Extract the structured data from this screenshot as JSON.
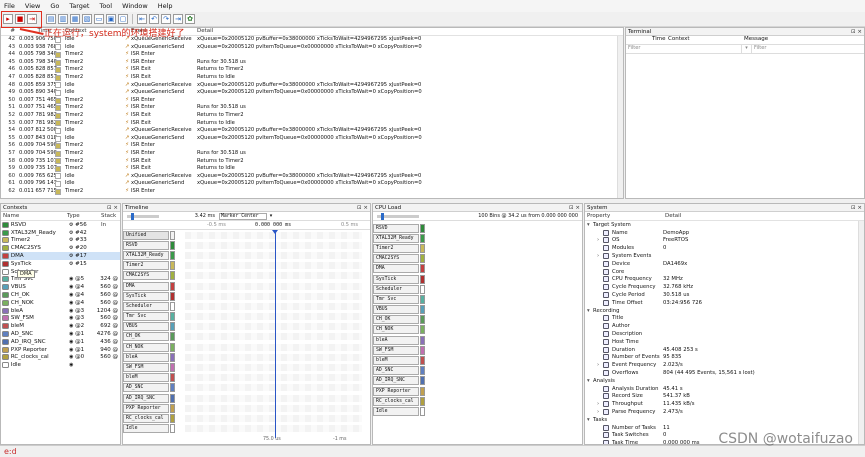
{
  "menu": [
    "File",
    "View",
    "Go",
    "Target",
    "Tool",
    "Window",
    "Help"
  ],
  "annotation": "正在运行，system的环境搭建好了",
  "events": {
    "columns": [
      "#",
      "Time",
      "Context",
      "",
      "Event",
      "Detail"
    ],
    "rows": [
      {
        "n": "42",
        "t": "0.003 906 750",
        "ctx": "Idle",
        "c": "#ffffff",
        "ic": "↗",
        "ev": "xQueueGenericReceive",
        "det": "xQueue=0x20005120 pvBuffer=0x38000000 xTicksToWait=4294967295 xJustPeek=0"
      },
      {
        "n": "43",
        "t": "0.003 938 768",
        "ctx": "Idle",
        "c": "#ffffff",
        "ic": "↗",
        "ev": "xQueueGenericSend",
        "det": "xQueue=0x20005120 pvItemToQueue=0x00000000 xTicksToWait=0 xCopyPosition=0"
      },
      {
        "n": "44",
        "t": "0.005 798 340",
        "ctx": "Timer2",
        "c": "#c8b85a",
        "ic": "⚡",
        "ev": "ISR Enter",
        "det": ""
      },
      {
        "n": "45",
        "t": "0.005 798 340",
        "ctx": "Timer2",
        "c": "#c8b85a",
        "ic": "⚡",
        "ev": "ISR Enter",
        "det": "Runs for 30.518 us"
      },
      {
        "n": "46",
        "t": "0.005 828 857",
        "ctx": "Timer2",
        "c": "#c8b85a",
        "ic": "⚡",
        "ev": "ISR Exit",
        "det": "Returns to Timer2"
      },
      {
        "n": "47",
        "t": "0.005 828 857",
        "ctx": "Timer2",
        "c": "#c8b85a",
        "ic": "⚡",
        "ev": "ISR Exit",
        "det": "Returns to Idle"
      },
      {
        "n": "48",
        "t": "0.005 859 375",
        "ctx": "Idle",
        "c": "#ffffff",
        "ic": "↗",
        "ev": "xQueueGenericReceive",
        "det": "xQueue=0x20005120 pvBuffer=0x38000000 xTicksToWait=4294967295 xJustPeek=0"
      },
      {
        "n": "49",
        "t": "0.005 890 340",
        "ctx": "Idle",
        "c": "#ffffff",
        "ic": "↗",
        "ev": "xQueueGenericSend",
        "det": "xQueue=0x20005120 pvItemToQueue=0x00000000 xTicksToWait=0 xCopyPosition=0"
      },
      {
        "n": "50",
        "t": "0.007 751 465",
        "ctx": "Timer2",
        "c": "#c8b85a",
        "ic": "⚡",
        "ev": "ISR Enter",
        "det": ""
      },
      {
        "n": "51",
        "t": "0.007 751 465",
        "ctx": "Timer2",
        "c": "#c8b85a",
        "ic": "⚡",
        "ev": "ISR Enter",
        "det": "Runs for 30.518 us"
      },
      {
        "n": "52",
        "t": "0.007 781 982",
        "ctx": "Timer2",
        "c": "#c8b85a",
        "ic": "⚡",
        "ev": "ISR Exit",
        "det": "Returns to Timer2"
      },
      {
        "n": "53",
        "t": "0.007 781 982",
        "ctx": "Timer2",
        "c": "#c8b85a",
        "ic": "⚡",
        "ev": "ISR Exit",
        "det": "Returns to Idle"
      },
      {
        "n": "54",
        "t": "0.007 812 500",
        "ctx": "Idle",
        "c": "#ffffff",
        "ic": "↗",
        "ev": "xQueueGenericReceive",
        "det": "xQueue=0x20005120 pvBuffer=0x38000000 xTicksToWait=4294967295 xJustPeek=0"
      },
      {
        "n": "55",
        "t": "0.007 843 018",
        "ctx": "Idle",
        "c": "#ffffff",
        "ic": "↗",
        "ev": "xQueueGenericSend",
        "det": "xQueue=0x20005120 pvItemToQueue=0x00000000 xTicksToWait=0 xCopyPosition=0"
      },
      {
        "n": "56",
        "t": "0.009 704 590",
        "ctx": "Timer2",
        "c": "#c8b85a",
        "ic": "⚡",
        "ev": "ISR Enter",
        "det": ""
      },
      {
        "n": "57",
        "t": "0.009 704 590",
        "ctx": "Timer2",
        "c": "#c8b85a",
        "ic": "⚡",
        "ev": "ISR Enter",
        "det": "Runs for 30.518 us"
      },
      {
        "n": "58",
        "t": "0.009 735 107",
        "ctx": "Timer2",
        "c": "#c8b85a",
        "ic": "⚡",
        "ev": "ISR Exit",
        "det": "Returns to Timer2"
      },
      {
        "n": "59",
        "t": "0.009 735 107",
        "ctx": "Timer2",
        "c": "#c8b85a",
        "ic": "⚡",
        "ev": "ISR Exit",
        "det": "Returns to Idle"
      },
      {
        "n": "60",
        "t": "0.009 765 625",
        "ctx": "Idle",
        "c": "#ffffff",
        "ic": "↗",
        "ev": "xQueueGenericReceive",
        "det": "xQueue=0x20005120 pvBuffer=0x38000000 xTicksToWait=4294967295 xJustPeek=0"
      },
      {
        "n": "61",
        "t": "0.009 796 143",
        "ctx": "Idle",
        "c": "#ffffff",
        "ic": "↗",
        "ev": "xQueueGenericSend",
        "det": "xQueue=0x20005120 pvItemToQueue=0x00000000 xTicksToWait=0 xCopyPosition=0"
      },
      {
        "n": "62",
        "t": "0.011 657 715",
        "ctx": "Timer2",
        "c": "#c8b85a",
        "ic": "⚡",
        "ev": "ISR Enter",
        "det": ""
      }
    ]
  },
  "terminal": {
    "title": "Terminal",
    "cols": [
      "Time",
      "Context",
      "Message"
    ],
    "filter": "Filter"
  },
  "contexts": {
    "title": "Contexts",
    "cols": [
      "Name",
      "Type",
      "Stack In"
    ],
    "rows": [
      {
        "name": "RSVD",
        "c": "#2e8b3a",
        "type": "⚙",
        "prio": "#56",
        "stack": ""
      },
      {
        "name": "XTAL32M_Ready",
        "c": "#3a9a4a",
        "type": "⚙",
        "prio": "#42",
        "stack": ""
      },
      {
        "name": "Timer2",
        "c": "#c8b85a",
        "type": "⚙",
        "prio": "#33",
        "stack": ""
      },
      {
        "name": "CMAC2SYS",
        "c": "#a0b040",
        "type": "⚙",
        "prio": "#20",
        "stack": ""
      },
      {
        "name": "DMA",
        "c": "#c44040",
        "type": "⚙",
        "prio": "#17",
        "stack": ""
      },
      {
        "name": "SysTick",
        "c": "#b03030",
        "type": "⚙",
        "prio": "#15",
        "stack": ""
      },
      {
        "name": "Scheduler",
        "c": "#ffffff",
        "type": "",
        "prio": "",
        "stack": ""
      },
      {
        "name": "Tmr Svc",
        "c": "#58b0a0",
        "type": "◉",
        "prio": "@5",
        "stack": "324 @"
      },
      {
        "name": "VBUS",
        "c": "#58a0b8",
        "type": "◉",
        "prio": "@4",
        "stack": "560 @"
      },
      {
        "name": "CH_OK",
        "c": "#5a9a5a",
        "type": "◉",
        "prio": "@4",
        "stack": "560 @"
      },
      {
        "name": "CH_NOK",
        "c": "#7ab060",
        "type": "◉",
        "prio": "@4",
        "stack": "560 @"
      },
      {
        "name": "bleA",
        "c": "#8a70b8",
        "type": "◉",
        "prio": "@3",
        "stack": "1204 @"
      },
      {
        "name": "SW_FSM",
        "c": "#c070b0",
        "type": "◉",
        "prio": "@3",
        "stack": "560 @"
      },
      {
        "name": "bleM",
        "c": "#c05050",
        "type": "◉",
        "prio": "@2",
        "stack": "692 @"
      },
      {
        "name": "AD_SNC",
        "c": "#6080c0",
        "type": "◉",
        "prio": "@1",
        "stack": "4276 @"
      },
      {
        "name": "AD_IRQ_SNC",
        "c": "#5070b0",
        "type": "◉",
        "prio": "@1",
        "stack": "436 @"
      },
      {
        "name": "PXP Reporter",
        "c": "#c0a050",
        "type": "◉",
        "prio": "@1",
        "stack": "940 @"
      },
      {
        "name": "RC_clocks_cal",
        "c": "#b0a040",
        "type": "◉",
        "prio": "@0",
        "stack": "560 @"
      },
      {
        "name": "Idle",
        "c": "#ffffff",
        "type": "◉",
        "prio": "",
        "stack": ""
      }
    ]
  },
  "tooltip": "DMA",
  "timeline": {
    "title": "Timeline",
    "zoom": "3.42 ms",
    "mode": "Marker Center",
    "center": "0.000 000 ms",
    "left_tick": "-0.5 ms",
    "right_tick": "0.5 ms",
    "bottom_left": "75.0 us",
    "bottom_right": "-1 ms",
    "rows": [
      {
        "label": "Unified",
        "c": "#f2f2f2"
      },
      {
        "label": "RSVD",
        "c": "#2e8b3a"
      },
      {
        "label": "XTAL32M_Ready",
        "c": "#3a9a4a"
      },
      {
        "label": "Timer2",
        "c": "#c8b85a"
      },
      {
        "label": "CMAC2SYS",
        "c": "#a0b040"
      },
      {
        "label": "DMA",
        "c": "#c44040"
      },
      {
        "label": "SysTick",
        "c": "#b03030"
      },
      {
        "label": "Scheduler",
        "c": "#ffffff"
      },
      {
        "label": "Tmr Svc",
        "c": "#58b0a0"
      },
      {
        "label": "VBUS",
        "c": "#58a0b8"
      },
      {
        "label": "CH_OK",
        "c": "#5a9a5a"
      },
      {
        "label": "CH_NOK",
        "c": "#7ab060"
      },
      {
        "label": "bleA",
        "c": "#8a70b8"
      },
      {
        "label": "SW_FSM",
        "c": "#c070b0"
      },
      {
        "label": "bleM",
        "c": "#c05050"
      },
      {
        "label": "AD_SNC",
        "c": "#6080c0"
      },
      {
        "label": "AD_IRQ_SNC",
        "c": "#5070b0"
      },
      {
        "label": "PXP Reporter",
        "c": "#c0a050"
      },
      {
        "label": "RC_clocks_cal",
        "c": "#b0a040"
      },
      {
        "label": "Idle",
        "c": "#ffffff"
      }
    ]
  },
  "cpu": {
    "title": "CPU Load",
    "header": "100 Bins @ 34.2 us from 0.000 000 000",
    "rows": [
      "RSVD",
      "XTAL32M_Ready",
      "Timer2",
      "CMAC2SYS",
      "DMA",
      "SysTick",
      "Scheduler",
      "Tmr Svc",
      "VBUS",
      "CH_OK",
      "CH_NOK",
      "bleA",
      "SW_FSM",
      "bleM",
      "AD_SNC",
      "AD_IRQ_SNC",
      "PXP Reporter",
      "RC_clocks_cal",
      "Idle"
    ]
  },
  "system": {
    "title": "System",
    "cols": [
      "Property",
      "Detail"
    ],
    "rows": [
      {
        "p": "Target System",
        "v": "",
        "lvl": 0,
        "exp": "▾"
      },
      {
        "p": "Name",
        "v": "DemoApp",
        "lvl": 1,
        "exp": ""
      },
      {
        "p": "OS",
        "v": "FreeRTOS",
        "lvl": 1,
        "exp": "›"
      },
      {
        "p": "Modules",
        "v": "0",
        "lvl": 1,
        "exp": ""
      },
      {
        "p": "System Events",
        "v": "",
        "lvl": 1,
        "exp": "›"
      },
      {
        "p": "Device",
        "v": "DA1469x",
        "lvl": 1,
        "exp": ""
      },
      {
        "p": "Core",
        "v": "",
        "lvl": 1,
        "exp": ""
      },
      {
        "p": "CPU Frequency",
        "v": "32 MHz",
        "lvl": 1,
        "exp": ""
      },
      {
        "p": "Cycle Frequency",
        "v": "32.768 kHz",
        "lvl": 1,
        "exp": ""
      },
      {
        "p": "Cycle Period",
        "v": "30.518 us",
        "lvl": 1,
        "exp": ""
      },
      {
        "p": "Time Offset",
        "v": "03:24:956 726",
        "lvl": 1,
        "exp": ""
      },
      {
        "p": "Recording",
        "v": "",
        "lvl": 0,
        "exp": "▾"
      },
      {
        "p": "Title",
        "v": "",
        "lvl": 1,
        "exp": ""
      },
      {
        "p": "Author",
        "v": "",
        "lvl": 1,
        "exp": ""
      },
      {
        "p": "Description",
        "v": "",
        "lvl": 1,
        "exp": ""
      },
      {
        "p": "Host Time",
        "v": "",
        "lvl": 1,
        "exp": ""
      },
      {
        "p": "Duration",
        "v": "45.408 253 s",
        "lvl": 1,
        "exp": ""
      },
      {
        "p": "Number of Events",
        "v": "95 835",
        "lvl": 1,
        "exp": ""
      },
      {
        "p": "Event Frequency",
        "v": "2.023/s",
        "lvl": 1,
        "exp": "›"
      },
      {
        "p": "Overflows",
        "v": "804 (44 495 Events, 15,561 s lost)",
        "lvl": 1,
        "exp": ""
      },
      {
        "p": "Analysis",
        "v": "",
        "lvl": 0,
        "exp": "▾"
      },
      {
        "p": "Analysis Duration",
        "v": "45.41 s",
        "lvl": 1,
        "exp": ""
      },
      {
        "p": "Record Size",
        "v": "541.37 kB",
        "lvl": 1,
        "exp": ""
      },
      {
        "p": "Throughput",
        "v": "11.435 kB/s",
        "lvl": 1,
        "exp": "›"
      },
      {
        "p": "Parse Frequency",
        "v": "2.473/s",
        "lvl": 1,
        "exp": "›"
      },
      {
        "p": "Tasks",
        "v": "",
        "lvl": 0,
        "exp": "▾"
      },
      {
        "p": "Number of Tasks",
        "v": "11",
        "lvl": 1,
        "exp": ""
      },
      {
        "p": "Task Switches",
        "v": "0",
        "lvl": 1,
        "exp": ""
      },
      {
        "p": "Task Time",
        "v": "0.000 000 ms",
        "lvl": 1,
        "exp": ""
      }
    ]
  },
  "status": "e:d",
  "watermark": "CSDN @wotaifuzao"
}
